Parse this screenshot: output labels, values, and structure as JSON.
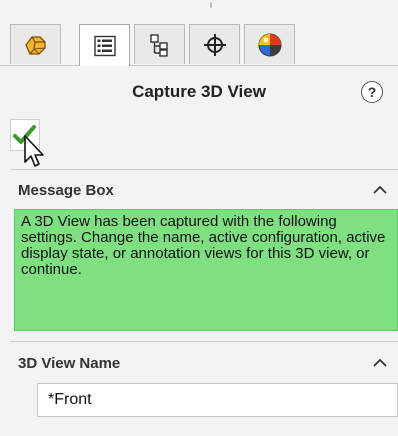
{
  "tabs": [
    {
      "name": "feature-manager",
      "icon": "feature-manager-icon",
      "active": false
    },
    {
      "name": "property-manager",
      "icon": "property-manager-icon",
      "active": true
    },
    {
      "name": "configuration-manager",
      "icon": "configuration-manager-icon",
      "active": false
    },
    {
      "name": "dimxpert-manager",
      "icon": "crosshair-icon",
      "active": false
    },
    {
      "name": "display-manager",
      "icon": "display-manager-icon",
      "active": false
    }
  ],
  "panel": {
    "title": "Capture 3D View",
    "help_icon": "question-mark-icon",
    "help_glyph": "?",
    "ok_icon": "checkmark-icon"
  },
  "message_box": {
    "header": "Message Box",
    "text": "A 3D View has been captured with the following settings.  Change the name, active configuration, active display state, or annotation views for this 3D view, or continue.",
    "background": "#7ee080"
  },
  "view_name": {
    "header": "3D View Name",
    "value": "*Front"
  },
  "colors": {
    "accent_check": "#3a9a2a",
    "message_green": "#7ee080"
  }
}
